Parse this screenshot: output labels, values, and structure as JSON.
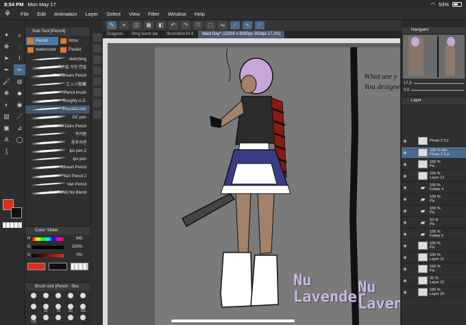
{
  "status": {
    "time": "8:54 PM",
    "date": "Mon May 17",
    "battery": "53%"
  },
  "menu": [
    "File",
    "Edit",
    "Animation",
    "Layer",
    "Select",
    "View",
    "Filter",
    "Window",
    "Help"
  ],
  "subtool": {
    "title": "Sub Tool [Pencil]",
    "categories": [
      "Pencil",
      "Intox",
      "watercolor",
      "Pastel"
    ],
    "brushes": [
      "sketching",
      "카스틸 거친 연필",
      "Sub Dream Pencil",
      "エッジ鉛筆",
      "Pencil brush",
      "Roughly A.S.",
      "Pencil&Color",
      "GC pen",
      "Homebrew Zaku Pencil",
      "쿠카펜",
      "음푸서센",
      "tps pen 2",
      "tps pen",
      "Lineart Pencil",
      "Vari Pencil 2",
      "Vari Pencil",
      "Vari Pencil No Blend"
    ],
    "selected_brush": "Pencil&Color"
  },
  "color_slider": {
    "title": "Color Slider",
    "h": {
      "label": "H",
      "value": "345"
    },
    "s": {
      "label": "S",
      "value": "100%"
    },
    "v": {
      "label": "V",
      "value": "0%"
    },
    "main_color": "#e02a1c"
  },
  "brush_size": {
    "title": "Brush size [Pencil - Sha",
    "sizes": [
      "",
      "",
      "",
      "",
      "",
      "",
      "60",
      "70",
      "80",
      "100",
      "120",
      "",
      "",
      "",
      "",
      ""
    ]
  },
  "tabs": [
    "Dragoon",
    "Hmg leash aw",
    "Illustration24 3",
    "Maid Day* (12000 x 8000px 350dpi 17.2%)"
  ],
  "canvas": {
    "side_text": [
      "What are y",
      "You designe"
    ],
    "brand_1": [
      "Nu",
      "Lavender"
    ],
    "brand_2": [
      "Nu",
      "Lavenc"
    ]
  },
  "navigator": {
    "title": "Navigator",
    "zoom": "17.2",
    "rotation": "0.0"
  },
  "layers": {
    "title": "Layer",
    "rows": [
      {
        "line1": "",
        "line2": "Photo 2 Co",
        "folder": false,
        "selected": false
      },
      {
        "line1": "100 %  Nor",
        "line2": "Photo 2 Col",
        "folder": false,
        "selected": true
      },
      {
        "line1": "100 %",
        "line2": "Pic",
        "folder": false,
        "selected": false
      },
      {
        "line1": "100 %",
        "line2": "Layer 12",
        "folder": false,
        "selected": false
      },
      {
        "line1": "100 %",
        "line2": "Folder 4",
        "folder": true,
        "selected": false
      },
      {
        "line1": "100 %",
        "line2": "Pic",
        "folder": true,
        "selected": false
      },
      {
        "line1": "100 %",
        "line2": "Pic",
        "folder": true,
        "selected": false
      },
      {
        "line1": "33 %",
        "line2": "Pic",
        "folder": true,
        "selected": false
      },
      {
        "line1": "100 %",
        "line2": "Folder 5",
        "folder": true,
        "selected": false
      },
      {
        "line1": "100 %",
        "line2": "Pic",
        "folder": false,
        "selected": false
      },
      {
        "line1": "100 %",
        "line2": "Layer 11",
        "folder": false,
        "selected": false
      },
      {
        "line1": "100 %",
        "line2": "Pic",
        "folder": false,
        "selected": false
      },
      {
        "line1": "33 %",
        "line2": "Layer 10",
        "folder": false,
        "selected": false
      },
      {
        "line1": "100 %",
        "line2": "Layer 26",
        "folder": false,
        "selected": false
      }
    ]
  }
}
